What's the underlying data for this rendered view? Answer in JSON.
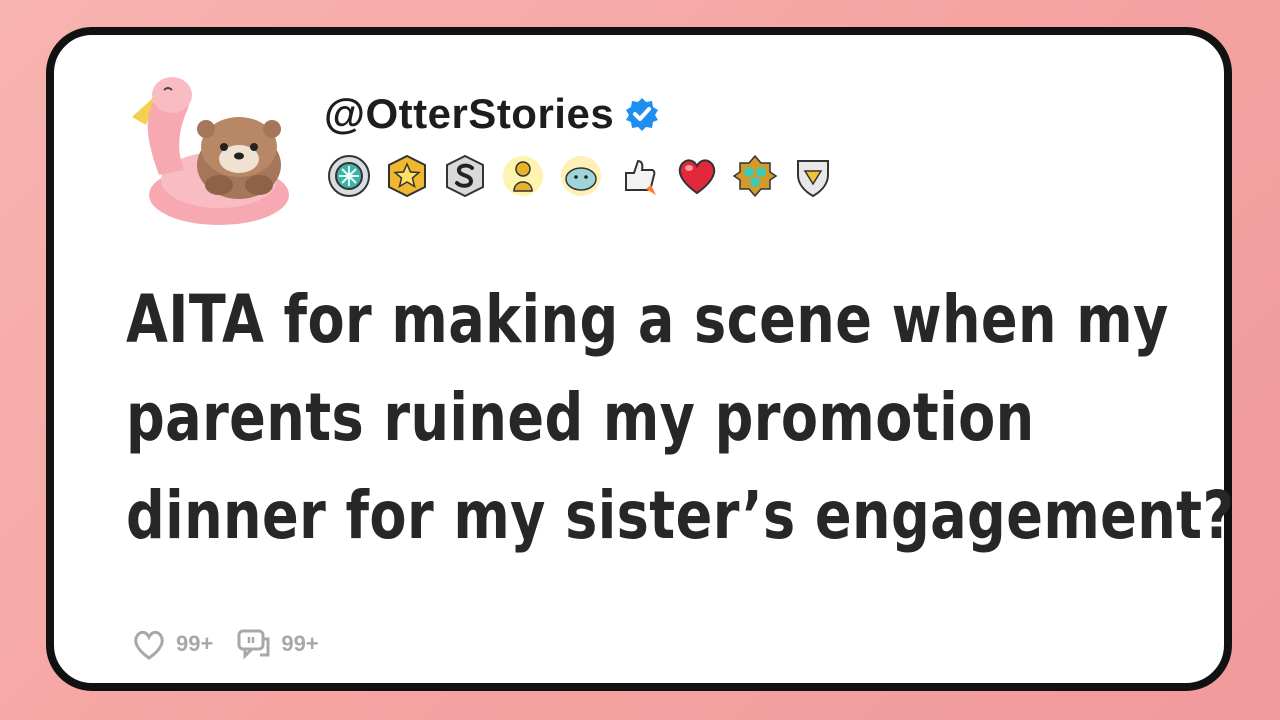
{
  "post": {
    "username": "@OtterStories",
    "verified_icon": "verified-check-icon",
    "title_lines": [
      "AITA for making a scene when my",
      "parents ruined my promotion",
      "dinner for my sister’s engagement?"
    ],
    "likes": "99+",
    "comments": "99+"
  },
  "badges": [
    "snowflake-award-icon",
    "star-award-icon",
    "s-letter-award-icon",
    "gold-figure-award-icon",
    "seal-award-icon",
    "thumbs-up-rocket-award-icon",
    "heart-award-icon",
    "gem-cluster-award-icon",
    "diamond-shield-award-icon"
  ],
  "colors": {
    "background": "#f5a4a2",
    "card": "#ffffff",
    "border": "#111111",
    "text": "#272727",
    "verified": "#1f8ef1",
    "meta": "#a8a8a8"
  }
}
